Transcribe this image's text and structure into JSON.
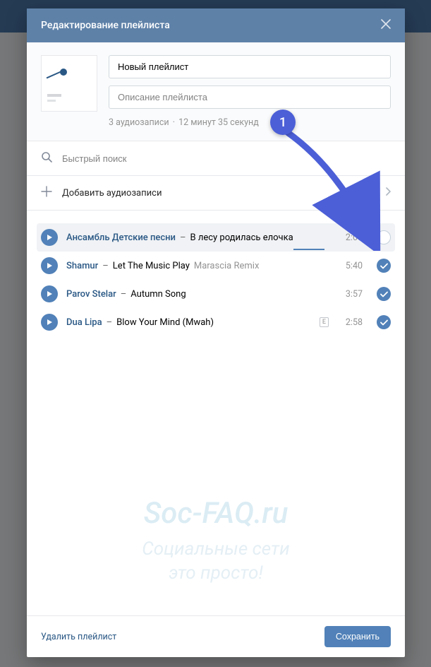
{
  "modal": {
    "title": "Редактирование плейлиста",
    "name_value": "Новый плейлист",
    "description_placeholder": "Описание плейлиста",
    "meta_count": "3 аудиозаписи",
    "meta_duration": "12 минут 35 секунд"
  },
  "search": {
    "placeholder": "Быстрый поиск"
  },
  "add_label": "Добавить аудиозаписи",
  "tracks": [
    {
      "artist": "Aнсамбль Детские песни",
      "title": "В лесу родилась елочка",
      "subtitle": "",
      "duration": "2:09",
      "selected": false,
      "explicit": false,
      "highlight": true
    },
    {
      "artist": "Shamur",
      "title": "Let The Music Play",
      "subtitle": "Marascia Remix",
      "duration": "5:40",
      "selected": true,
      "explicit": false,
      "highlight": false
    },
    {
      "artist": "Parov Stelar",
      "title": "Autumn Song",
      "subtitle": "",
      "duration": "3:57",
      "selected": true,
      "explicit": false,
      "highlight": false
    },
    {
      "artist": "Dua Lipa",
      "title": "Blow Your Mind (Mwah)",
      "subtitle": "",
      "duration": "2:58",
      "selected": true,
      "explicit": true,
      "highlight": false
    }
  ],
  "footer": {
    "delete": "Удалить плейлист",
    "save": "Сохранить"
  },
  "watermark": {
    "line1": "Soc-FAQ.ru",
    "line2": "Социальные сети",
    "line3": "это просто!"
  },
  "annotation": {
    "number": "1"
  }
}
